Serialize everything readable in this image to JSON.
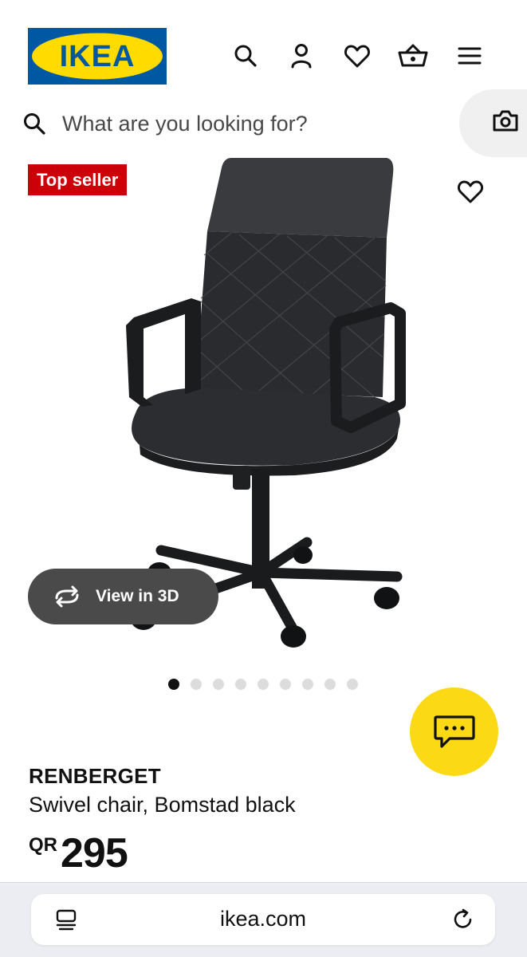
{
  "header": {
    "logo_text": "IKEA",
    "brand_colors": {
      "blue": "#0058a3",
      "yellow": "#ffdb00"
    },
    "icons": [
      "search-icon",
      "user-icon",
      "heart-icon",
      "basket-icon",
      "menu-icon"
    ]
  },
  "search": {
    "placeholder": "What are you looking for?",
    "value": "",
    "icon": "search-icon",
    "camera_icon": "camera-icon"
  },
  "media": {
    "badge": "Top seller",
    "badge_color": "#cc0008",
    "favourite_icon": "heart-icon",
    "view3d_label": "View in 3D",
    "view3d_icon": "rotate-icon",
    "image_count": 9,
    "active_image_index": 0
  },
  "chat": {
    "icon": "chat-bubble-icon",
    "color": "#fbd914"
  },
  "product": {
    "name": "RENBERGET",
    "description": "Swivel chair, Bomstad black",
    "currency": "QR",
    "price": "295"
  },
  "browser": {
    "url": "ikea.com",
    "left_icon": "reader-icon",
    "right_icon": "reload-icon"
  }
}
